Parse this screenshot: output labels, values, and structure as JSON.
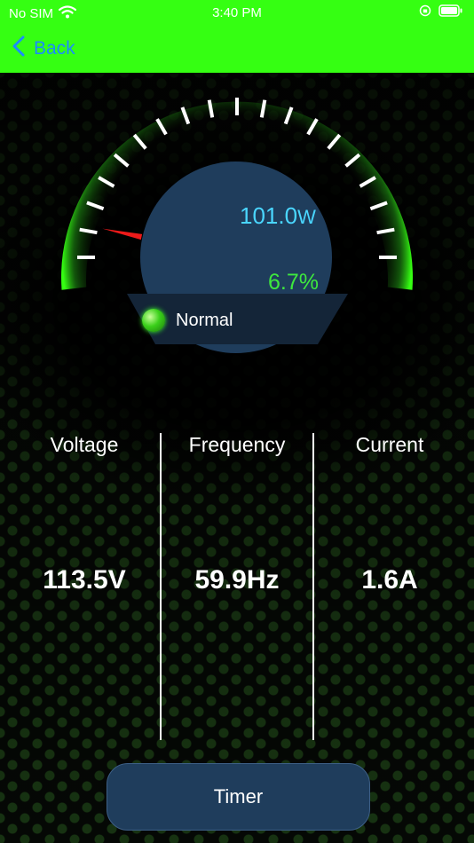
{
  "status_bar": {
    "carrier": "No SIM",
    "time": "3:40 PM",
    "icons": [
      "wifi-icon",
      "orientation-lock-icon",
      "battery-icon"
    ]
  },
  "nav": {
    "back_label": "Back",
    "accent_color": "#35ff12",
    "link_color": "#1a8cff"
  },
  "gauge": {
    "power_value": "101.0",
    "power_unit": "W",
    "percent_label": "6.7%",
    "percent_value": 6.7,
    "status_label": "Normal",
    "status_color": "#3ad01a"
  },
  "metrics": [
    {
      "label": "Voltage",
      "value": "113.5V"
    },
    {
      "label": "Frequency",
      "value": "59.9Hz"
    },
    {
      "label": "Current",
      "value": "1.6A"
    }
  ],
  "timer_label": "Timer"
}
